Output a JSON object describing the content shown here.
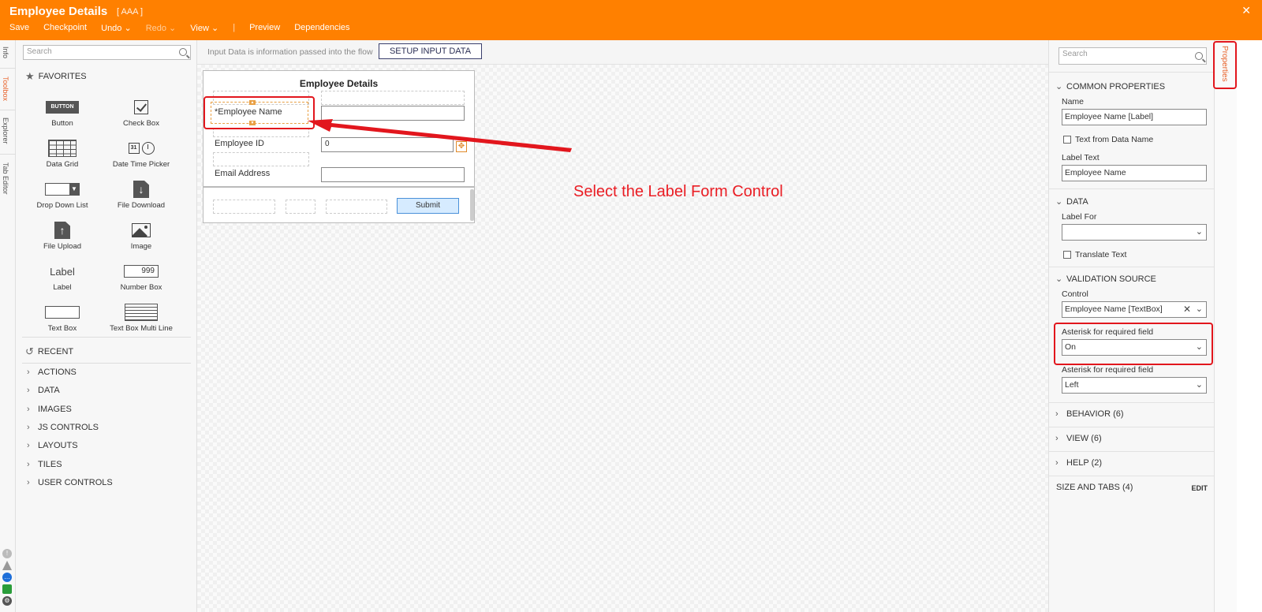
{
  "header": {
    "title": "Employee Details",
    "subtitle": "[ AAA ]",
    "close": "✕",
    "menu": {
      "save": "Save",
      "checkpoint": "Checkpoint",
      "undo": "Undo ⌄",
      "redo": "Redo ⌄",
      "view": "View ⌄",
      "sep": "|",
      "preview": "Preview",
      "dependencies": "Dependencies"
    }
  },
  "left_tabs": [
    "Info",
    "Toolbox",
    "Explorer",
    "Tab Editor"
  ],
  "toolbox": {
    "search_placeholder": "Search",
    "favorites_label": "FAVORITES",
    "tools": [
      {
        "label": "Button",
        "icon_text": "BUTTON"
      },
      {
        "label": "Check Box"
      },
      {
        "label": "Data Grid"
      },
      {
        "label": "Date Time Picker",
        "icon_text": "31"
      },
      {
        "label": "Drop Down List"
      },
      {
        "label": "File Download"
      },
      {
        "label": "File Upload"
      },
      {
        "label": "Image"
      },
      {
        "label": "Label",
        "icon_text": "Label"
      },
      {
        "label": "Number Box",
        "icon_text": "999"
      },
      {
        "label": "Text Box"
      },
      {
        "label": "Text Box Multi Line"
      }
    ],
    "recent_label": "RECENT",
    "categories": [
      "ACTIONS",
      "DATA",
      "IMAGES",
      "JS CONTROLS",
      "LAYOUTS",
      "TILES",
      "USER CONTROLS"
    ]
  },
  "canvas": {
    "info_text": "Input Data is information passed into the flow",
    "setup_button": "SETUP INPUT DATA",
    "form": {
      "title": "Employee Details",
      "fields": [
        {
          "label": "*Employee Name",
          "value": ""
        },
        {
          "label": "Employee ID",
          "value": "0"
        },
        {
          "label": "Email Address",
          "value": ""
        }
      ],
      "submit": "Submit"
    },
    "annotation": "Select the Label Form Control"
  },
  "properties": {
    "tab_label": "Properties",
    "search_placeholder": "Search",
    "common": {
      "header": "COMMON PROPERTIES",
      "name_label": "Name",
      "name_value": "Employee  Name [Label]",
      "text_from_data_name": "Text from Data Name",
      "label_text_label": "Label Text",
      "label_text_value": "Employee  Name"
    },
    "data": {
      "header": "DATA",
      "label_for": "Label For",
      "label_for_value": "",
      "translate_text": "Translate Text"
    },
    "validation": {
      "header": "VALIDATION SOURCE",
      "control_label": "Control",
      "control_value": "Employee Name [TextBox]",
      "asterisk_label": "Asterisk for required field",
      "asterisk_value": "On",
      "asterisk_label2": "Asterisk for required field",
      "asterisk_value2": "Left"
    },
    "behavior": "BEHAVIOR (6)",
    "view": "VIEW (6)",
    "help": "HELP (2)",
    "size_tabs": "SIZE AND TABS (4)",
    "edit": "EDIT"
  },
  "colors": {
    "header_bg": "#ff8000",
    "highlight_red": "#e2161d",
    "annotation_red": "#ea1d24"
  }
}
